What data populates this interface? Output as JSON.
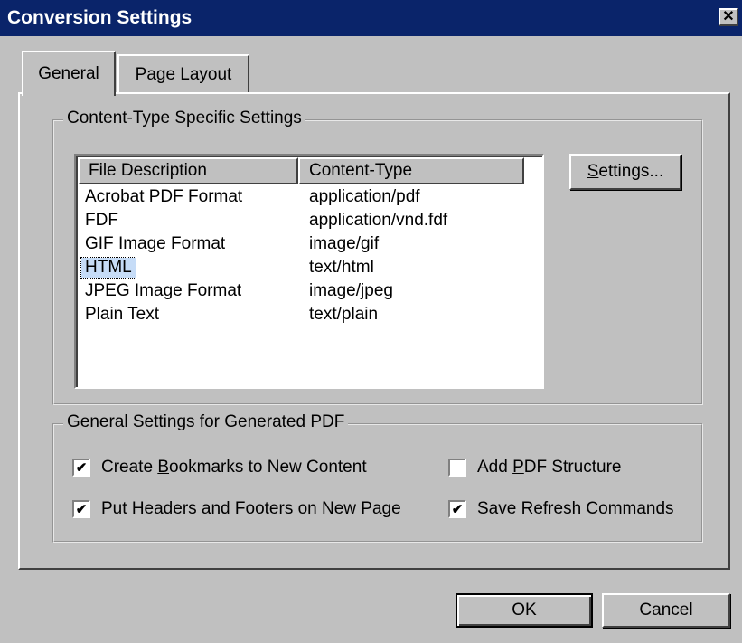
{
  "window": {
    "title": "Conversion Settings",
    "close_glyph": "✕"
  },
  "tabs": [
    {
      "label": "General",
      "active": true
    },
    {
      "label": "Page Layout",
      "active": false
    }
  ],
  "content_group": {
    "label": "Content-Type Specific Settings",
    "columns": [
      "File Description",
      "Content-Type"
    ],
    "rows": [
      {
        "desc": "Acrobat PDF Format",
        "type": "application/pdf"
      },
      {
        "desc": "FDF",
        "type": "application/vnd.fdf"
      },
      {
        "desc": "GIF Image Format",
        "type": "image/gif"
      },
      {
        "desc": "HTML",
        "type": "text/html",
        "selected": true
      },
      {
        "desc": "JPEG Image Format",
        "type": "image/jpeg"
      },
      {
        "desc": "Plain Text",
        "type": "text/plain"
      }
    ],
    "settings_button": {
      "pre": "",
      "mnemonic": "S",
      "post": "ettings..."
    }
  },
  "general_group": {
    "label": "General Settings for Generated PDF",
    "options": [
      {
        "pre": "Create ",
        "mnemonic": "B",
        "post": "ookmarks to New Content",
        "checked": true
      },
      {
        "pre": "Put ",
        "mnemonic": "H",
        "post": "eaders and Footers on New Page",
        "checked": true
      },
      {
        "pre": "Add ",
        "mnemonic": "P",
        "post": "DF Structure",
        "checked": false
      },
      {
        "pre": "Save ",
        "mnemonic": "R",
        "post": "efresh Commands",
        "checked": true
      }
    ]
  },
  "buttons": {
    "ok": "OK",
    "cancel": "Cancel"
  },
  "colors": {
    "titlebar": "#0a246a",
    "face": "#c0c0c0",
    "selection": "#c6dcf7"
  }
}
